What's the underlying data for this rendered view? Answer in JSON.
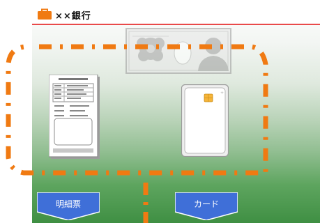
{
  "header": {
    "bank_name": "××銀行",
    "accent_color": "#e94a4a",
    "icon": "orange-briefcase-icon"
  },
  "illustrations": {
    "background": "banknote-illustration",
    "left_item": "statement-slip-illustration",
    "right_item": "cash-card-illustration"
  },
  "buttons": {
    "statement_label": "明細票",
    "card_label": "カード",
    "color": "#3f6fd8"
  },
  "highlight": {
    "style": "orange dash-dot outline",
    "color": "#f07a12"
  }
}
